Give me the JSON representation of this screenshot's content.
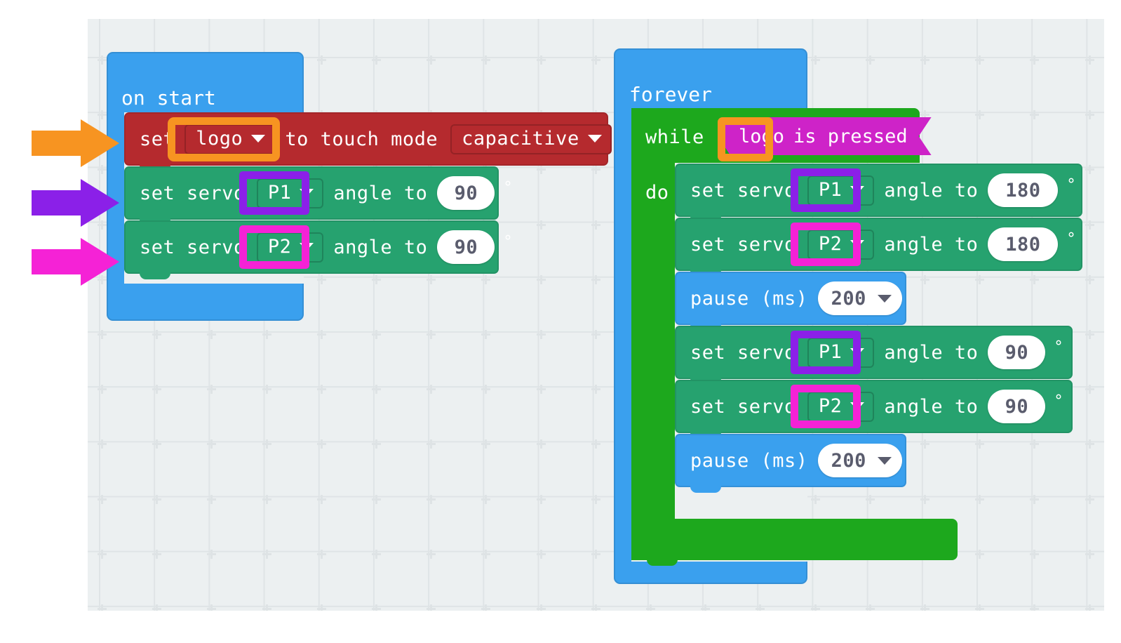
{
  "app": {
    "kind": "makecode-blocks-workspace",
    "canvas_background": "#ecf0f1",
    "grid_marker": "plus-cross"
  },
  "palette": {
    "blue": "#3AA0EE",
    "teal": "#26A26F",
    "green": "#1DA81D",
    "red": "#B52A2E",
    "magenta": "#CE23C8",
    "highlight_orange": "#F79421",
    "highlight_purple": "#8B20E8",
    "highlight_pink": "#F522D6",
    "field_white": "#FFFFFF",
    "field_text": "#5A5C6D"
  },
  "scripts": {
    "on_start": {
      "hat_label": "on start",
      "blocks": [
        {
          "id": "set-touch-mode",
          "color": "red",
          "text_before": "set",
          "dropdown_1": "logo",
          "text_middle": "to touch mode",
          "dropdown_2": "capacitive",
          "highlight": "orange"
        },
        {
          "id": "set-servo-p1-start",
          "color": "teal",
          "text_before": "set servo",
          "dropdown_1": "P1",
          "text_middle": "angle to",
          "value": "90",
          "unit": "°",
          "highlight": "purple"
        },
        {
          "id": "set-servo-p2-start",
          "color": "teal",
          "text_before": "set servo",
          "dropdown_1": "P2",
          "text_middle": "angle to",
          "value": "90",
          "unit": "°",
          "highlight": "pink"
        }
      ]
    },
    "forever": {
      "hat_label": "forever",
      "while_label": "while",
      "do_label": "do",
      "condition": {
        "subject": "logo",
        "predicate": "is pressed",
        "highlight": "orange"
      },
      "body": [
        {
          "id": "set-servo-p1-180",
          "color": "teal",
          "text_before": "set servo",
          "dropdown_1": "P1",
          "text_middle": "angle to",
          "value": "180",
          "unit": "°",
          "highlight": "purple"
        },
        {
          "id": "set-servo-p2-180",
          "color": "teal",
          "text_before": "set servo",
          "dropdown_1": "P2",
          "text_middle": "angle to",
          "value": "180",
          "unit": "°",
          "highlight": "pink"
        },
        {
          "id": "pause-200-a",
          "color": "blue",
          "text_before": "pause (ms)",
          "value": "200",
          "dropdown": true
        },
        {
          "id": "set-servo-p1-90",
          "color": "teal",
          "text_before": "set servo",
          "dropdown_1": "P1",
          "text_middle": "angle to",
          "value": "90",
          "unit": "°",
          "highlight": "purple"
        },
        {
          "id": "set-servo-p2-90",
          "color": "teal",
          "text_before": "set servo",
          "dropdown_1": "P2",
          "text_middle": "angle to",
          "value": "90",
          "unit": "°",
          "highlight": "pink"
        },
        {
          "id": "pause-200-b",
          "color": "blue",
          "text_before": "pause (ms)",
          "value": "200",
          "dropdown": true
        }
      ]
    }
  },
  "annotations": {
    "arrows": [
      {
        "name": "arrow-to-touch-mode",
        "color": "#F79421",
        "points_at": "set logo to touch mode capacitive"
      },
      {
        "name": "arrow-to-servo-p1",
        "color": "#8B20E8",
        "points_at": "set servo P1 angle to 90"
      },
      {
        "name": "arrow-to-servo-p2",
        "color": "#F522D6",
        "points_at": "set servo P2 angle to 90"
      }
    ]
  }
}
